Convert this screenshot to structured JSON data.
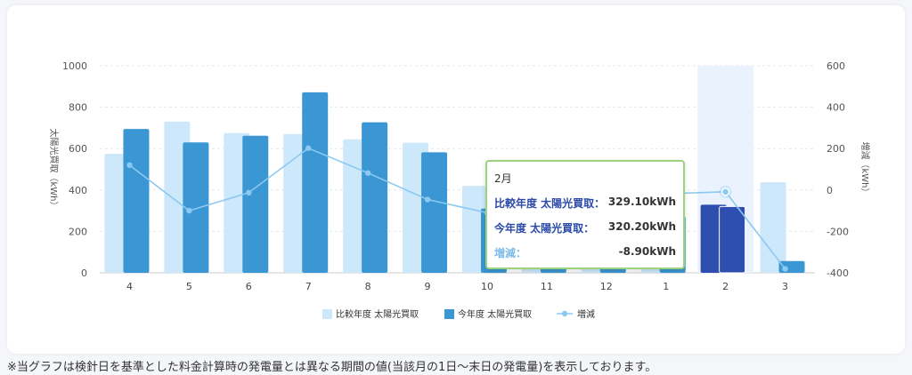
{
  "chart_data": {
    "type": "bar",
    "categories": [
      "4",
      "5",
      "6",
      "7",
      "8",
      "9",
      "10",
      "11",
      "12",
      "1",
      "2",
      "3"
    ],
    "series": [
      {
        "name": "比較年度 太陽光買取",
        "type": "bar",
        "axis": "left",
        "values": [
          575,
          730,
          675,
          670,
          645,
          628,
          420,
          300,
          300,
          290,
          329.1,
          438
        ],
        "color": "#cde8fb"
      },
      {
        "name": "今年度 太陽光買取",
        "type": "bar",
        "axis": "left",
        "values": [
          695,
          630,
          662,
          872,
          727,
          582,
          310,
          268,
          268,
          272,
          320.2,
          57
        ],
        "color": "#3a97d4"
      },
      {
        "name": "増減",
        "type": "line",
        "axis": "right",
        "values": [
          120,
          -100,
          -13,
          202,
          82,
          -46,
          -110,
          -32,
          -32,
          -18,
          -8.9,
          -381
        ],
        "color": "#8cc9f0"
      }
    ],
    "highlight": {
      "index": 10,
      "bar_color": "#2e4fb0"
    },
    "left_axis": {
      "label": "太陽光買取（kWh）",
      "ylim": [
        0,
        1000
      ],
      "ticks": [
        "1000",
        "800",
        "600",
        "400",
        "200",
        "0"
      ]
    },
    "right_axis": {
      "label": "増減（kWh）",
      "ylim": [
        -400,
        600
      ],
      "ticks": [
        "600",
        "400",
        "200",
        "0",
        "-200",
        "-400"
      ]
    },
    "grid": true,
    "legend_position": "bottom"
  },
  "tooltip": {
    "title": "2月",
    "rows": [
      {
        "label": "比較年度 太陽光買取：",
        "value": "329.10kWh",
        "color": "#2b4aa8"
      },
      {
        "label": "今年度 太陽光買取：",
        "value": "320.20kWh",
        "color": "#2b4aa8"
      },
      {
        "label": "増減：",
        "value": "-8.90kWh",
        "color": "#7dbbea"
      }
    ]
  },
  "note": "※当グラフは検針日を基準とした料金計算時の発電量とは異なる期間の値(当該月の1日～末日の発電量)を表示しております。"
}
